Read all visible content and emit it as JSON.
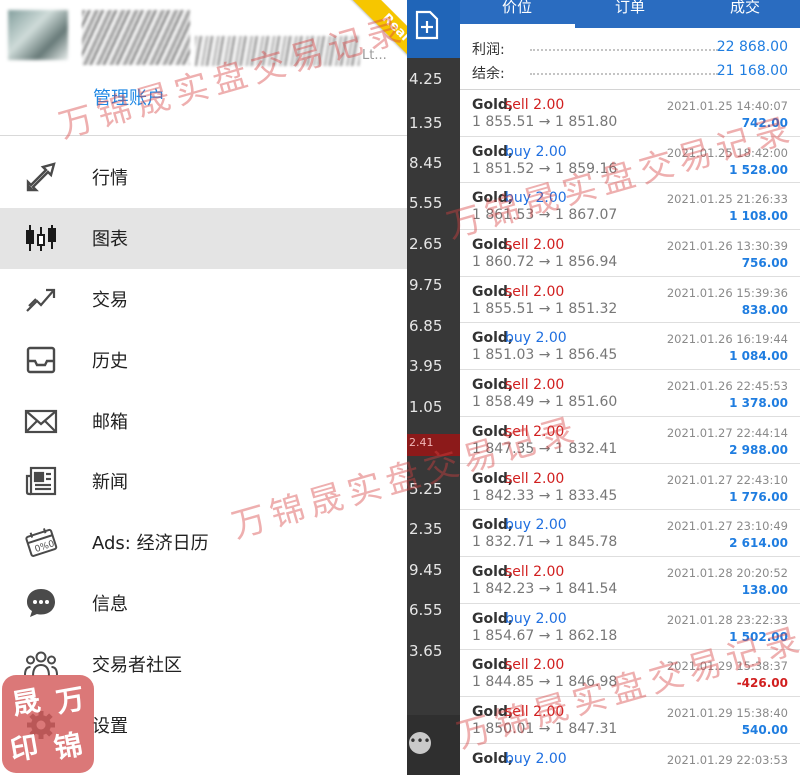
{
  "drawer": {
    "manage_account": "管理账户",
    "badge": "Real",
    "account_tail": "Lt...",
    "items": [
      {
        "label": "行情",
        "icon": "quotes-arrows-icon",
        "active": false
      },
      {
        "label": "图表",
        "icon": "candlestick-icon",
        "active": true
      },
      {
        "label": "交易",
        "icon": "trade-chart-icon",
        "active": false
      },
      {
        "label": "历史",
        "icon": "history-inbox-icon",
        "active": false
      },
      {
        "label": "邮箱",
        "icon": "mail-icon",
        "active": false
      },
      {
        "label": "新闻",
        "icon": "news-icon",
        "active": false
      },
      {
        "label": "Ads: 经济日历",
        "icon": "calendar-icon",
        "active": false
      },
      {
        "label": "信息",
        "icon": "chat-icon",
        "active": false
      },
      {
        "label": "交易者社区",
        "icon": "community-icon",
        "active": false
      },
      {
        "label": "设置",
        "icon": "gear-icon",
        "active": false
      }
    ]
  },
  "middle": {
    "prices": [
      "4.25",
      "1.35",
      "8.45",
      "5.55",
      "2.65",
      "9.75",
      "6.85",
      "3.95",
      "1.05",
      "5.25",
      "2.35",
      "9.45",
      "6.55",
      "3.65"
    ],
    "highlight": "2.41"
  },
  "history": {
    "tabs": [
      "价位",
      "订单",
      "成交"
    ],
    "summary": [
      {
        "label": "利润:",
        "value": "22 868.00"
      },
      {
        "label": "结余:",
        "value": "21 168.00"
      }
    ],
    "trades": [
      {
        "symbol": "Gold,",
        "action": "sell 2.00",
        "side": "sell",
        "prices": "1 855.51 → 1 851.80",
        "time": "2021.01.25 14:40:07",
        "profit": "742.00"
      },
      {
        "symbol": "Gold,",
        "action": "buy 2.00",
        "side": "buy",
        "prices": "1 851.52 → 1 859.16",
        "time": "2021.01.25 18:42:00",
        "profit": "1 528.00"
      },
      {
        "symbol": "Gold,",
        "action": "buy 2.00",
        "side": "buy",
        "prices": "1 861.53 → 1 867.07",
        "time": "2021.01.25 21:26:33",
        "profit": "1 108.00"
      },
      {
        "symbol": "Gold,",
        "action": "sell 2.00",
        "side": "sell",
        "prices": "1 860.72 → 1 856.94",
        "time": "2021.01.26 13:30:39",
        "profit": "756.00"
      },
      {
        "symbol": "Gold,",
        "action": "sell 2.00",
        "side": "sell",
        "prices": "1 855.51 → 1 851.32",
        "time": "2021.01.26 15:39:36",
        "profit": "838.00"
      },
      {
        "symbol": "Gold,",
        "action": "buy 2.00",
        "side": "buy",
        "prices": "1 851.03 → 1 856.45",
        "time": "2021.01.26 16:19:44",
        "profit": "1 084.00"
      },
      {
        "symbol": "Gold,",
        "action": "sell 2.00",
        "side": "sell",
        "prices": "1 858.49 → 1 851.60",
        "time": "2021.01.26 22:45:53",
        "profit": "1 378.00"
      },
      {
        "symbol": "Gold,",
        "action": "sell 2.00",
        "side": "sell",
        "prices": "1 847.35 → 1 832.41",
        "time": "2021.01.27 22:44:14",
        "profit": "2 988.00"
      },
      {
        "symbol": "Gold,",
        "action": "sell 2.00",
        "side": "sell",
        "prices": "1 842.33 → 1 833.45",
        "time": "2021.01.27 22:43:10",
        "profit": "1 776.00"
      },
      {
        "symbol": "Gold,",
        "action": "buy 2.00",
        "side": "buy",
        "prices": "1 832.71 → 1 845.78",
        "time": "2021.01.27 23:10:49",
        "profit": "2 614.00"
      },
      {
        "symbol": "Gold,",
        "action": "sell 2.00",
        "side": "sell",
        "prices": "1 842.23 → 1 841.54",
        "time": "2021.01.28 20:20:52",
        "profit": "138.00"
      },
      {
        "symbol": "Gold,",
        "action": "buy 2.00",
        "side": "buy",
        "prices": "1 854.67 → 1 862.18",
        "time": "2021.01.28 23:22:33",
        "profit": "1 502.00"
      },
      {
        "symbol": "Gold,",
        "action": "sell 2.00",
        "side": "sell",
        "prices": "1 844.85 → 1 846.98",
        "time": "2021.01.29 15:38:37",
        "profit": "-426.00"
      },
      {
        "symbol": "Gold,",
        "action": "sell 2.00",
        "side": "sell",
        "prices": "1 850.01 → 1 847.31",
        "time": "2021.01.29 15:38:40",
        "profit": "540.00"
      },
      {
        "symbol": "Gold,",
        "action": "buy 2.00",
        "side": "buy",
        "prices": "",
        "time": "2021.01.29 22:03:53",
        "profit": ""
      }
    ]
  },
  "watermark": {
    "text": "万锦晟实盘交易记录",
    "seal_chars": [
      "晟",
      "万",
      "印",
      "锦"
    ]
  },
  "colors": {
    "sell": "#d11f1f",
    "buy": "#1f6fe0",
    "profit_positive": "#1f7de0",
    "profit_negative": "#d11f1f",
    "header_blue": "#2a6cc0",
    "link_blue": "#1f88e5",
    "badge_yellow": "#f6c600"
  }
}
